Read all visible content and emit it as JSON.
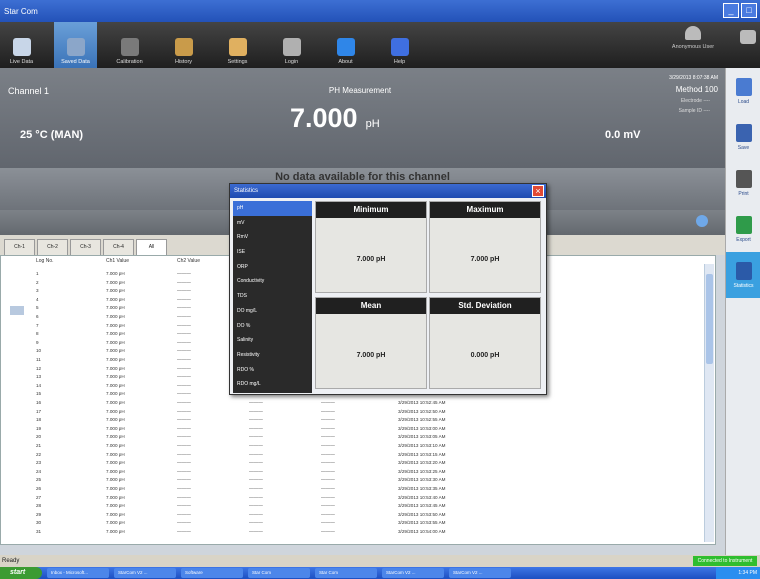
{
  "app_title": "Star Com",
  "window_buttons": [
    "_",
    "□"
  ],
  "toolbar": [
    {
      "label": "Live Data",
      "icon": "monitor-icon"
    },
    {
      "label": "Saved Data",
      "icon": "database-icon",
      "active": true
    },
    {
      "label": "Calibration",
      "icon": "calibration-icon"
    },
    {
      "label": "History",
      "icon": "history-icon"
    },
    {
      "label": "Settings",
      "icon": "settings-icon"
    },
    {
      "label": "Login",
      "icon": "login-icon"
    },
    {
      "label": "About",
      "icon": "about-icon"
    },
    {
      "label": "Help",
      "icon": "help-icon"
    }
  ],
  "user_label": "Anonymous User",
  "header": {
    "channel": "Channel 1",
    "measurement_title": "PH Measurement",
    "value": "7.000",
    "unit": "pH",
    "temperature": "25 °C (MAN)",
    "mv": "0.0 mV",
    "timestamp": "3/29/2013 8:07:38 AM",
    "method": "Method 100",
    "electrode": "Electrode ----",
    "sample_id": "Sample ID ----"
  },
  "no_data_message": "No data available for this channel",
  "tabs": [
    "Ch-1",
    "Ch-2",
    "Ch-3",
    "Ch-4",
    "All"
  ],
  "right_panel": [
    {
      "label": "Load",
      "icon": "load-icon"
    },
    {
      "label": "Save",
      "icon": "save-icon"
    },
    {
      "label": "Print",
      "icon": "print-icon"
    },
    {
      "label": "Export",
      "icon": "export-icon"
    },
    {
      "label": "Statistics",
      "icon": "statistics-icon",
      "active": true
    }
  ],
  "table": {
    "headers": [
      "Log No.",
      "Ch1 Value",
      "Ch2 Value"
    ],
    "ch_value": "7.000 pH",
    "empty": "———",
    "rows": [
      {
        "no": "1"
      },
      {
        "no": "2"
      },
      {
        "no": "3"
      },
      {
        "no": "4"
      },
      {
        "no": "5"
      },
      {
        "no": "6"
      },
      {
        "no": "7"
      },
      {
        "no": "8"
      },
      {
        "no": "9"
      },
      {
        "no": "10"
      },
      {
        "no": "11"
      },
      {
        "no": "12"
      },
      {
        "no": "13"
      },
      {
        "no": "14"
      },
      {
        "no": "15",
        "time": "3/29/2013 10:52:40 AM"
      },
      {
        "no": "16",
        "time": "3/29/2013 10:52:45 AM"
      },
      {
        "no": "17",
        "time": "3/29/2013 10:52:50 AM"
      },
      {
        "no": "18",
        "time": "3/29/2013 10:52:55 AM"
      },
      {
        "no": "19",
        "time": "3/29/2013 10:53:00 AM"
      },
      {
        "no": "20",
        "time": "3/29/2013 10:53:05 AM"
      },
      {
        "no": "21",
        "time": "3/29/2013 10:53:10 AM"
      },
      {
        "no": "22",
        "time": "3/29/2013 10:53:15 AM"
      },
      {
        "no": "23",
        "time": "3/29/2013 10:53:20 AM"
      },
      {
        "no": "24",
        "time": "3/29/2013 10:53:25 AM"
      },
      {
        "no": "25",
        "time": "3/29/2013 10:53:30 AM"
      },
      {
        "no": "26",
        "time": "3/29/2013 10:53:35 AM"
      },
      {
        "no": "27",
        "time": "3/29/2013 10:53:40 AM"
      },
      {
        "no": "28",
        "time": "3/29/2013 10:53:45 AM"
      },
      {
        "no": "29",
        "time": "3/29/2013 10:53:50 AM"
      },
      {
        "no": "30",
        "time": "3/29/2013 10:53:55 AM"
      },
      {
        "no": "31",
        "time": "3/29/2013 10:54:00 AM"
      }
    ]
  },
  "dialog": {
    "title": "Statistics",
    "params": [
      "pH",
      "mV",
      "RmV",
      "ISE",
      "ORP",
      "Conductivity",
      "TDS",
      "DO mg/L",
      "DO %",
      "Salinity",
      "Resistivity",
      "RDO %",
      "RDO mg/L"
    ],
    "selected_param": "pH",
    "stats": [
      {
        "label": "Minimum",
        "value": "7.000 pH"
      },
      {
        "label": "Maximum",
        "value": "7.000 pH"
      },
      {
        "label": "Mean",
        "value": "7.000 pH"
      },
      {
        "label": "Std. Deviation",
        "value": "0.000 pH"
      }
    ]
  },
  "status": {
    "text": "Ready",
    "connection": "Connected to Instrument"
  },
  "taskbar": {
    "start_label": "start",
    "tasks": [
      "Inbox - Microsoft...",
      "StarCom V2 ...",
      "Software",
      "Star Com",
      "Star Com",
      "StarCom V2 ...",
      "StarCom V2 ..."
    ],
    "clock": "1:34 PM"
  }
}
